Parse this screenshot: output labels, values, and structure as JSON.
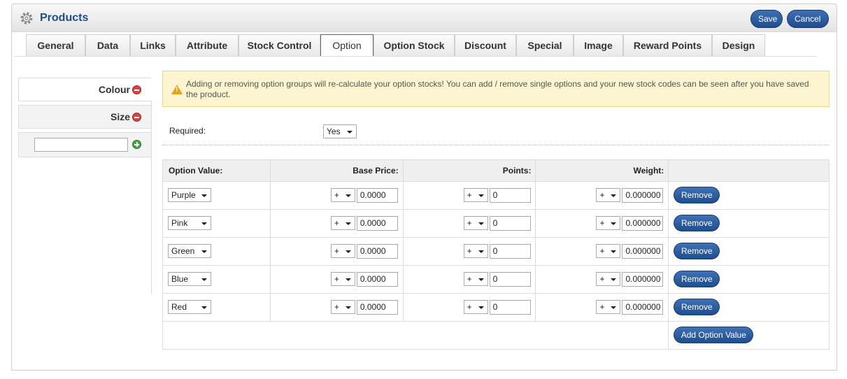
{
  "header": {
    "title": "Products",
    "save_label": "Save",
    "cancel_label": "Cancel",
    "icon": "gear-icon"
  },
  "tabs": [
    {
      "label": "General"
    },
    {
      "label": "Data"
    },
    {
      "label": "Links"
    },
    {
      "label": "Attribute"
    },
    {
      "label": "Stock Control"
    },
    {
      "label": "Option"
    },
    {
      "label": "Option Stock"
    },
    {
      "label": "Discount"
    },
    {
      "label": "Special"
    },
    {
      "label": "Image"
    },
    {
      "label": "Reward Points"
    },
    {
      "label": "Design"
    }
  ],
  "active_tab": "Option",
  "option_groups": [
    {
      "label": "Colour"
    },
    {
      "label": "Size"
    }
  ],
  "new_option_input": {
    "value": ""
  },
  "warning": "Adding or removing option groups will re-calculate your option stocks! You can add / remove single options and your new stock codes can be seen after you have saved the product.",
  "required": {
    "label": "Required:",
    "value": "Yes"
  },
  "table": {
    "headers": {
      "option_value": "Option Value:",
      "base_price": "Base Price:",
      "points": "Points:",
      "weight": "Weight:"
    },
    "rows": [
      {
        "value": "Purple",
        "price_prefix": "+",
        "price": "0.0000",
        "points_prefix": "+",
        "points": "0",
        "weight_prefix": "+",
        "weight": "0.000000",
        "remove": "Remove"
      },
      {
        "value": "Pink",
        "price_prefix": "+",
        "price": "0.0000",
        "points_prefix": "+",
        "points": "0",
        "weight_prefix": "+",
        "weight": "0.000000",
        "remove": "Remove"
      },
      {
        "value": "Green",
        "price_prefix": "+",
        "price": "0.0000",
        "points_prefix": "+",
        "points": "0",
        "weight_prefix": "+",
        "weight": "0.000000",
        "remove": "Remove"
      },
      {
        "value": "Blue",
        "price_prefix": "+",
        "price": "0.0000",
        "points_prefix": "+",
        "points": "0",
        "weight_prefix": "+",
        "weight": "0.000000",
        "remove": "Remove"
      },
      {
        "value": "Red",
        "price_prefix": "+",
        "price": "0.0000",
        "points_prefix": "+",
        "points": "0",
        "weight_prefix": "+",
        "weight": "0.000000",
        "remove": "Remove"
      }
    ],
    "add_label": "Add Option Value"
  },
  "colors": {
    "accent": "#1f4e8f",
    "title": "#1f4d86",
    "warning_bg": "#fdf5cf"
  }
}
